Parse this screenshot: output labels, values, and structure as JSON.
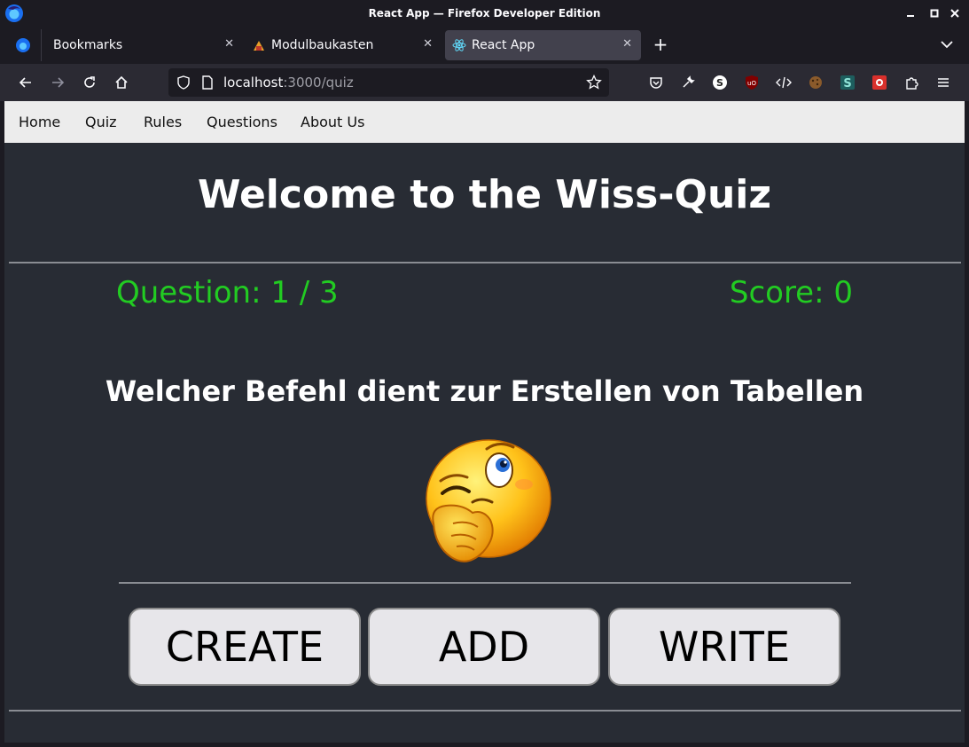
{
  "window": {
    "title": "React App — Firefox Developer Edition"
  },
  "tabs": [
    {
      "label": "Bookmarks",
      "active": false
    },
    {
      "label": "Modulbaukasten",
      "active": false
    },
    {
      "label": "React App",
      "active": true
    }
  ],
  "url": {
    "host": "localhost",
    "path": ":3000/quiz"
  },
  "app_nav": {
    "items": [
      "Home",
      "Quiz",
      "Rules",
      "Questions",
      "About Us"
    ]
  },
  "page": {
    "heading": "Welcome to the Wiss-Quiz",
    "question_counter": "Question: 1 / 3",
    "score": "Score: 0",
    "question": "Welcher Befehl dient zur Erstellen von Tabellen",
    "answers": [
      "CREATE",
      "ADD",
      "WRITE"
    ]
  },
  "colors": {
    "page_bg": "#282c34",
    "accent_green": "#22cc22",
    "button_bg": "#e7e6ea"
  }
}
